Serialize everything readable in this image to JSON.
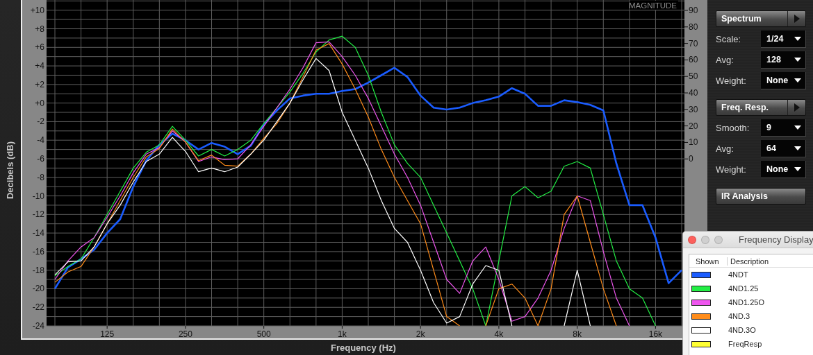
{
  "chart": {
    "magnitude_axis": {
      "title": "MAGNITUDE",
      "ticks": [
        "90",
        "80",
        "70",
        "60",
        "50",
        "40",
        "30",
        "20",
        "10",
        "0"
      ]
    },
    "chart_data": {
      "type": "line",
      "grid": true,
      "xlabel": "Frequency (Hz)",
      "ylabel": "Decibels (dB)",
      "ylim": [
        -24,
        11.1
      ],
      "categories": [
        null,
        null,
        null,
        null,
        "125",
        null,
        null,
        null,
        null,
        null,
        "250",
        null,
        null,
        null,
        null,
        null,
        "500",
        null,
        null,
        null,
        null,
        null,
        "1k",
        null,
        null,
        null,
        null,
        null,
        "2k",
        null,
        null,
        null,
        null,
        null,
        "4k",
        null,
        null,
        null,
        null,
        null,
        "8k",
        null,
        null,
        null,
        null,
        null,
        "16k",
        null,
        null
      ],
      "yticks": [
        {
          "value": 10,
          "label": "+10"
        },
        {
          "value": 8,
          "label": "+8"
        },
        {
          "value": 6,
          "label": "+6"
        },
        {
          "value": 4,
          "label": "+4"
        },
        {
          "value": 2,
          "label": "+2"
        },
        {
          "value": 0,
          "label": "+0"
        },
        {
          "value": -2,
          "label": "-2"
        },
        {
          "value": -4,
          "label": "-4"
        },
        {
          "value": -6,
          "label": "-6"
        },
        {
          "value": -8,
          "label": "-8"
        },
        {
          "value": -10,
          "label": "-10"
        },
        {
          "value": -12,
          "label": "-12"
        },
        {
          "value": -14,
          "label": "-14"
        },
        {
          "value": -16,
          "label": "-16"
        },
        {
          "value": -18,
          "label": "-18"
        },
        {
          "value": -20,
          "label": "-20"
        },
        {
          "value": -22,
          "label": "-22"
        },
        {
          "value": -24,
          "label": "-24"
        }
      ],
      "series": [
        {
          "name": "4NDT",
          "color": "#1a5cff",
          "values": [
            -20,
            -17.7,
            -16.8,
            -15.8,
            -14,
            -12.5,
            -9,
            -6.2,
            -4.5,
            -3.3,
            -4,
            -5,
            -4.3,
            -4.7,
            -5.5,
            -4.6,
            -2.3,
            -0.8,
            0.5,
            0.8,
            1.0,
            1.0,
            1.3,
            1.5,
            2.2,
            3.0,
            3.8,
            2.8,
            0.8,
            -0.5,
            -0.7,
            -0.5,
            0,
            0.3,
            0.7,
            1.6,
            1.0,
            -0.3,
            -0.3,
            0.3,
            0.1,
            -0.2,
            -0.8,
            -6.5,
            -11,
            -11,
            -14.5,
            -19.4,
            -18
          ]
        },
        {
          "name": "4ND1.25",
          "color": "#22ee44",
          "values": [
            -18.6,
            -17.6,
            -16.8,
            -14.5,
            -12,
            -9.5,
            -7,
            -5.3,
            -4.5,
            -2.5,
            -4,
            -5.7,
            -5,
            -5.7,
            -5,
            -4,
            -2.2,
            -0.5,
            1.2,
            3.2,
            5.5,
            6.8,
            7.2,
            6,
            3,
            -1,
            -4.5,
            -6.5,
            -8,
            -11,
            -14,
            -17,
            -20,
            -24,
            -17,
            -10,
            -9,
            -10.2,
            -9.5,
            -6.8,
            -6.3,
            -7,
            -12,
            -17,
            -20,
            -21,
            -24,
            null,
            null
          ]
        },
        {
          "name": "4ND1.25O",
          "color": "#ee55ee",
          "values": [
            -19,
            -17,
            -15.5,
            -14.5,
            -12.3,
            -10,
            -7.5,
            -5.5,
            -4.8,
            -3.0,
            -4.2,
            -6.3,
            -5.8,
            -6.1,
            -6.0,
            -4.5,
            -2.5,
            -0.5,
            1.5,
            3.8,
            6.5,
            6.6,
            5,
            3,
            0.5,
            -2.5,
            -5.5,
            -8,
            -11,
            -15,
            -19,
            -20.5,
            -17,
            -15.5,
            -19,
            -23.5,
            -23,
            -21,
            -18,
            -13.5,
            -10,
            -10.5,
            -16,
            -21,
            -24,
            null,
            null,
            null,
            null
          ]
        },
        {
          "name": "4ND.3",
          "color": "#ff8c1a",
          "values": [
            -19.3,
            -18.2,
            -17.6,
            -15.5,
            -13,
            -10.5,
            -8,
            -5.8,
            -4.9,
            -2.8,
            -4.2,
            -6.2,
            -5.6,
            -6.7,
            -6.8,
            -5.5,
            -3.8,
            -2.2,
            0,
            2.8,
            5.7,
            6.4,
            4.2,
            1.5,
            -1.5,
            -5,
            -8,
            -10.5,
            -13,
            -18,
            -23,
            -24,
            null,
            -24,
            -20,
            -19.5,
            -21,
            -24,
            -20,
            -12,
            -10,
            -15,
            -20,
            -24,
            null,
            null,
            null,
            null,
            null
          ]
        },
        {
          "name": "4ND.3O",
          "color": "#ffffff",
          "values": [
            -18.5,
            -17.1,
            -17,
            -15.5,
            -13,
            -11,
            -8.5,
            -6.3,
            -5.5,
            -3.7,
            -5.2,
            -7.4,
            -7,
            -7.4,
            -6.9,
            -5.5,
            -4,
            -2,
            0,
            2.5,
            4.8,
            3.5,
            -1,
            -4,
            -7,
            -10.5,
            -13.5,
            -15,
            -18,
            -21.5,
            -23.7,
            -23,
            -19.5,
            -17.5,
            -18,
            -24,
            null,
            null,
            null,
            -24,
            -18,
            -24,
            null,
            null,
            null,
            null,
            null,
            null,
            null
          ]
        }
      ]
    }
  },
  "controls": [
    {
      "kind": "menu",
      "title": "Spectrum",
      "fields": [
        {
          "label": "Scale:",
          "value": "1/24"
        },
        {
          "label": "Avg:",
          "value": "128"
        },
        {
          "label": "Weight:",
          "value": "None"
        }
      ]
    },
    {
      "kind": "menu",
      "title": "Freq. Resp.",
      "fields": [
        {
          "label": "Smooth:",
          "value": "9"
        },
        {
          "label": "Avg:",
          "value": "64"
        },
        {
          "label": "Weight:",
          "value": "None"
        }
      ]
    },
    {
      "kind": "plain",
      "title": "IR Analysis"
    }
  ],
  "legend_window": {
    "title": "Frequency Display",
    "columns": [
      "Shown",
      "Description"
    ],
    "extra_rows": [
      {
        "label": "FreqResp",
        "color": "#ffff33"
      }
    ]
  }
}
